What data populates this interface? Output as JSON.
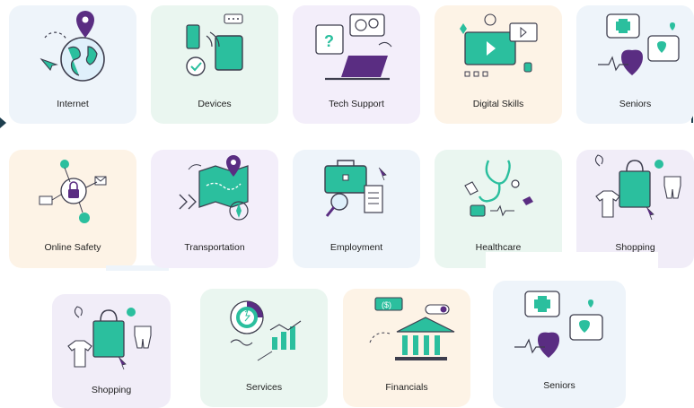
{
  "tiles": [
    {
      "label": "Internet",
      "icon": "globe-location-icon"
    },
    {
      "label": "Devices",
      "icon": "devices-icon"
    },
    {
      "label": "Tech Support",
      "icon": "laptop-support-icon"
    },
    {
      "label": "Digital Skills",
      "icon": "digital-skills-icon"
    },
    {
      "label": "Seniors",
      "icon": "seniors-health-icon"
    },
    {
      "label": "Online Safety",
      "icon": "online-safety-lock-icon"
    },
    {
      "label": "Transportation",
      "icon": "map-route-icon"
    },
    {
      "label": "Employment",
      "icon": "briefcase-icon"
    },
    {
      "label": "Healthcare",
      "icon": "stethoscope-icon"
    },
    {
      "label": "Shopping",
      "icon": "shopping-bag-icon"
    },
    {
      "label": "Shopping",
      "icon": "shopping-bag-icon"
    },
    {
      "label": "Services",
      "icon": "services-chart-icon"
    },
    {
      "label": "Financials",
      "icon": "bank-icon"
    },
    {
      "label": "Seniors",
      "icon": "seniors-health-icon"
    }
  ],
  "colors": {
    "teal": "#2bbf9e",
    "purple": "#5a2d82",
    "outline": "#3d3d4d",
    "accent_pink": "#e64b7a"
  }
}
